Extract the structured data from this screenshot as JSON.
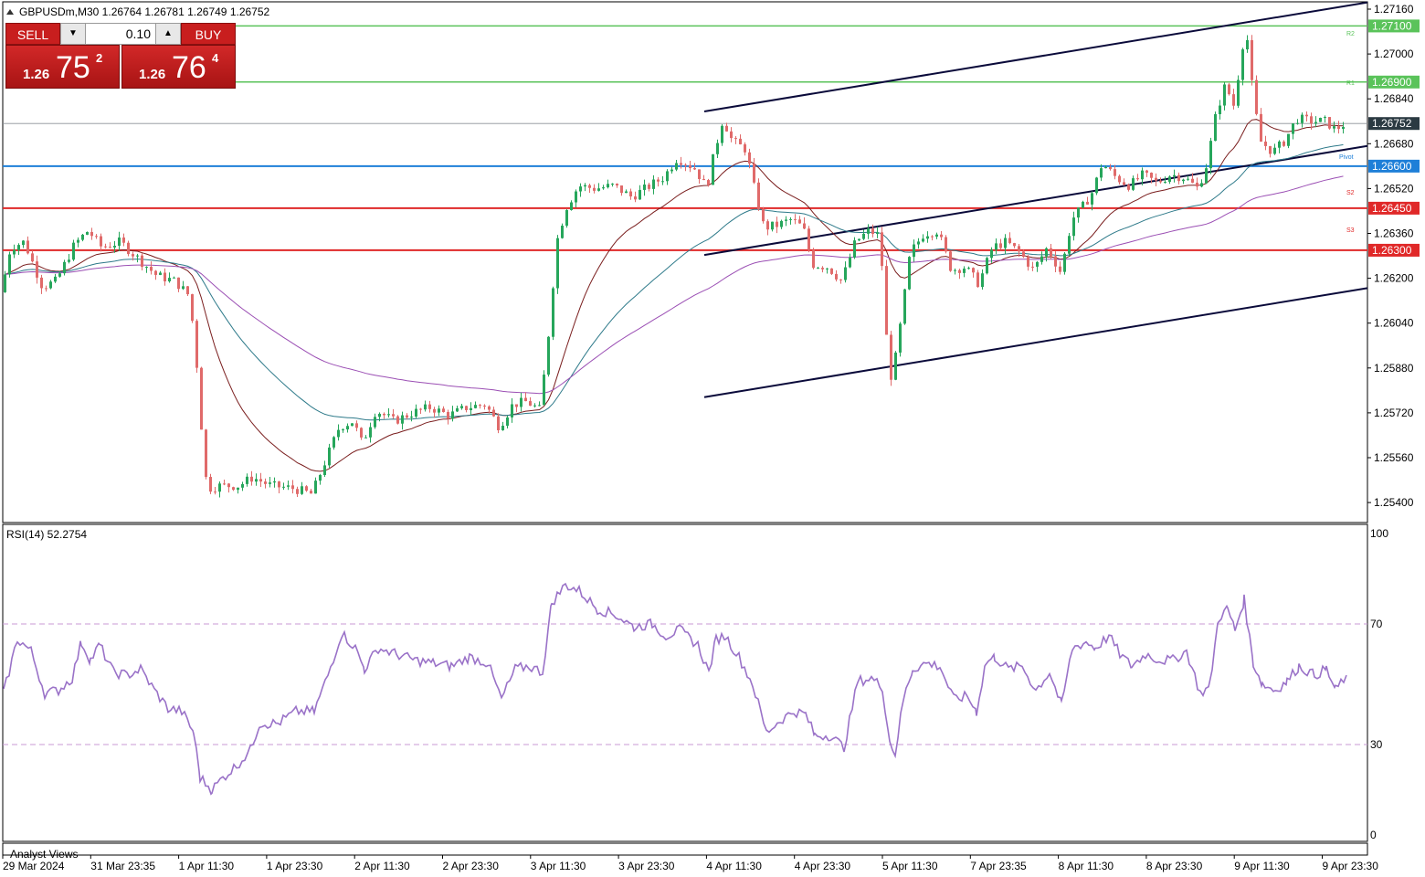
{
  "header": {
    "symbol_info": "GBPUSDm,M30  1.26764 1.26781 1.26749 1.26752"
  },
  "trade_panel": {
    "sell_label": "SELL",
    "buy_label": "BUY",
    "lot": "0.10",
    "sell_price_small": "1.26",
    "sell_price_big": "75",
    "sell_price_sup": "2",
    "buy_price_small": "1.26",
    "buy_price_big": "76",
    "buy_price_sup": "4"
  },
  "colors": {
    "bull": "#26a65b",
    "bear": "#e06a6a",
    "resistance": "#5ac35a",
    "pivot": "#1e7fd8",
    "support": "#e02828",
    "channel": "#0a0a3a",
    "ma_fast": "#7a1e1e",
    "ma_mid": "#2e7a8a",
    "ma_slow": "#9b4fb4",
    "rsi": "#9a72c8",
    "current_price_box": "#2b3a42"
  },
  "rsi_panel": {
    "label": "RSI(14) 52.2754",
    "level_labels": [
      "100",
      "70",
      "30",
      "0"
    ]
  },
  "analyst_label": "Analyst Views",
  "level_tags": {
    "r2": "R2",
    "r1": "R1",
    "pivot": "Pivot",
    "s2": "S2",
    "s3": "S3"
  },
  "chart_data": [
    {
      "type": "candlestick",
      "title": "GBPUSDm,M30",
      "x_tick_labels": [
        "29 Mar 2024",
        "31 Mar 23:35",
        "1 Apr 11:30",
        "1 Apr 23:30",
        "2 Apr 11:30",
        "2 Apr 23:30",
        "3 Apr 11:30",
        "3 Apr 23:30",
        "4 Apr 11:30",
        "4 Apr 23:30",
        "5 Apr 11:30",
        "7 Apr 23:35",
        "8 Apr 11:30",
        "8 Apr 23:30",
        "9 Apr 11:30",
        "9 Apr 23:30"
      ],
      "y_tick_labels": [
        "1.27160",
        "1.27000",
        "1.26840",
        "1.26680",
        "1.26520",
        "1.26360",
        "1.26200",
        "1.26040",
        "1.25880",
        "1.25720",
        "1.25560",
        "1.25400"
      ],
      "ylim": [
        1.2534,
        1.2719
      ],
      "horizontal_levels": [
        {
          "label": "1.27100",
          "value": 1.271,
          "kind": "resistance"
        },
        {
          "label": "1.26900",
          "value": 1.269,
          "kind": "resistance"
        },
        {
          "label": "1.26600",
          "value": 1.266,
          "kind": "pivot"
        },
        {
          "label": "1.26450",
          "value": 1.2645,
          "kind": "support"
        },
        {
          "label": "1.26300",
          "value": 1.263,
          "kind": "support"
        }
      ],
      "current_price": {
        "label": "1.26752",
        "value": 1.26752
      },
      "close_path": [
        {
          "x": 0,
          "y": 1.2615
        },
        {
          "x": 10,
          "y": 1.2631
        },
        {
          "x": 25,
          "y": 1.2633
        },
        {
          "x": 45,
          "y": 1.2617
        },
        {
          "x": 60,
          "y": 1.2619
        },
        {
          "x": 80,
          "y": 1.2632
        },
        {
          "x": 95,
          "y": 1.2637
        },
        {
          "x": 110,
          "y": 1.2631
        },
        {
          "x": 130,
          "y": 1.2633
        },
        {
          "x": 150,
          "y": 1.2627
        },
        {
          "x": 170,
          "y": 1.2621
        },
        {
          "x": 190,
          "y": 1.2619
        },
        {
          "x": 205,
          "y": 1.2614
        },
        {
          "x": 212,
          "y": 1.2598
        },
        {
          "x": 218,
          "y": 1.2571
        },
        {
          "x": 225,
          "y": 1.2545
        },
        {
          "x": 240,
          "y": 1.2546
        },
        {
          "x": 260,
          "y": 1.2546
        },
        {
          "x": 275,
          "y": 1.2549
        },
        {
          "x": 295,
          "y": 1.2546
        },
        {
          "x": 320,
          "y": 1.2545
        },
        {
          "x": 340,
          "y": 1.2543
        },
        {
          "x": 355,
          "y": 1.2555
        },
        {
          "x": 370,
          "y": 1.2567
        },
        {
          "x": 385,
          "y": 1.2569
        },
        {
          "x": 395,
          "y": 1.2561
        },
        {
          "x": 410,
          "y": 1.2573
        },
        {
          "x": 430,
          "y": 1.2569
        },
        {
          "x": 450,
          "y": 1.2572
        },
        {
          "x": 470,
          "y": 1.2574
        },
        {
          "x": 490,
          "y": 1.2571
        },
        {
          "x": 510,
          "y": 1.2574
        },
        {
          "x": 530,
          "y": 1.2575
        },
        {
          "x": 545,
          "y": 1.2567
        },
        {
          "x": 560,
          "y": 1.2575
        },
        {
          "x": 575,
          "y": 1.2576
        },
        {
          "x": 590,
          "y": 1.2573
        },
        {
          "x": 600,
          "y": 1.2603
        },
        {
          "x": 608,
          "y": 1.2633
        },
        {
          "x": 618,
          "y": 1.2645
        },
        {
          "x": 632,
          "y": 1.2653
        },
        {
          "x": 650,
          "y": 1.2652
        },
        {
          "x": 670,
          "y": 1.2653
        },
        {
          "x": 690,
          "y": 1.2649
        },
        {
          "x": 710,
          "y": 1.2653
        },
        {
          "x": 725,
          "y": 1.2656
        },
        {
          "x": 740,
          "y": 1.2663
        },
        {
          "x": 760,
          "y": 1.2659
        },
        {
          "x": 772,
          "y": 1.2652
        },
        {
          "x": 780,
          "y": 1.2664
        },
        {
          "x": 790,
          "y": 1.2677
        },
        {
          "x": 800,
          "y": 1.2669
        },
        {
          "x": 815,
          "y": 1.2666
        },
        {
          "x": 825,
          "y": 1.2651
        },
        {
          "x": 835,
          "y": 1.2638
        },
        {
          "x": 850,
          "y": 1.2639
        },
        {
          "x": 865,
          "y": 1.2641
        },
        {
          "x": 878,
          "y": 1.2638
        },
        {
          "x": 888,
          "y": 1.2625
        },
        {
          "x": 905,
          "y": 1.2624
        },
        {
          "x": 920,
          "y": 1.2619
        },
        {
          "x": 935,
          "y": 1.2633
        },
        {
          "x": 950,
          "y": 1.2637
        },
        {
          "x": 962,
          "y": 1.2635
        },
        {
          "x": 970,
          "y": 1.2594
        },
        {
          "x": 975,
          "y": 1.2583
        },
        {
          "x": 985,
          "y": 1.2605
        },
        {
          "x": 995,
          "y": 1.2629
        },
        {
          "x": 1010,
          "y": 1.2636
        },
        {
          "x": 1025,
          "y": 1.2637
        },
        {
          "x": 1040,
          "y": 1.2623
        },
        {
          "x": 1055,
          "y": 1.2624
        },
        {
          "x": 1070,
          "y": 1.2618
        },
        {
          "x": 1085,
          "y": 1.2631
        },
        {
          "x": 1100,
          "y": 1.2633
        },
        {
          "x": 1115,
          "y": 1.2629
        },
        {
          "x": 1130,
          "y": 1.2623
        },
        {
          "x": 1145,
          "y": 1.2631
        },
        {
          "x": 1160,
          "y": 1.2622
        },
        {
          "x": 1172,
          "y": 1.2641
        },
        {
          "x": 1185,
          "y": 1.2646
        },
        {
          "x": 1195,
          "y": 1.2651
        },
        {
          "x": 1205,
          "y": 1.2661
        },
        {
          "x": 1220,
          "y": 1.2656
        },
        {
          "x": 1235,
          "y": 1.2653
        },
        {
          "x": 1250,
          "y": 1.2657
        },
        {
          "x": 1265,
          "y": 1.2654
        },
        {
          "x": 1280,
          "y": 1.2657
        },
        {
          "x": 1295,
          "y": 1.2656
        },
        {
          "x": 1310,
          "y": 1.2652
        },
        {
          "x": 1320,
          "y": 1.2661
        },
        {
          "x": 1330,
          "y": 1.2679
        },
        {
          "x": 1340,
          "y": 1.2689
        },
        {
          "x": 1350,
          "y": 1.2681
        },
        {
          "x": 1358,
          "y": 1.2703
        },
        {
          "x": 1364,
          "y": 1.2705
        },
        {
          "x": 1370,
          "y": 1.2686
        },
        {
          "x": 1378,
          "y": 1.2669
        },
        {
          "x": 1392,
          "y": 1.2665
        },
        {
          "x": 1405,
          "y": 1.2669
        },
        {
          "x": 1418,
          "y": 1.2677
        },
        {
          "x": 1435,
          "y": 1.2676
        },
        {
          "x": 1450,
          "y": 1.2676
        },
        {
          "x": 1460,
          "y": 1.2673
        },
        {
          "x": 1470,
          "y": 1.2675
        }
      ]
    },
    {
      "type": "line",
      "title": "RSI(14) 52.2754",
      "ylim": [
        0,
        100
      ],
      "y_ticks": [
        0,
        30,
        70,
        100
      ],
      "reference_levels": [
        70,
        30
      ],
      "series": [
        {
          "name": "RSI(14)",
          "points": [
            {
              "x": 0,
              "y": 47
            },
            {
              "x": 15,
              "y": 65
            },
            {
              "x": 30,
              "y": 61
            },
            {
              "x": 45,
              "y": 47
            },
            {
              "x": 60,
              "y": 48
            },
            {
              "x": 75,
              "y": 52
            },
            {
              "x": 85,
              "y": 64
            },
            {
              "x": 95,
              "y": 58
            },
            {
              "x": 105,
              "y": 63
            },
            {
              "x": 120,
              "y": 54
            },
            {
              "x": 135,
              "y": 53
            },
            {
              "x": 150,
              "y": 55
            },
            {
              "x": 165,
              "y": 48
            },
            {
              "x": 180,
              "y": 42
            },
            {
              "x": 195,
              "y": 41
            },
            {
              "x": 208,
              "y": 34
            },
            {
              "x": 215,
              "y": 19
            },
            {
              "x": 228,
              "y": 15
            },
            {
              "x": 240,
              "y": 19
            },
            {
              "x": 255,
              "y": 23
            },
            {
              "x": 270,
              "y": 28
            },
            {
              "x": 280,
              "y": 37
            },
            {
              "x": 300,
              "y": 37
            },
            {
              "x": 320,
              "y": 41
            },
            {
              "x": 340,
              "y": 41
            },
            {
              "x": 355,
              "y": 53
            },
            {
              "x": 370,
              "y": 67
            },
            {
              "x": 385,
              "y": 62
            },
            {
              "x": 395,
              "y": 55
            },
            {
              "x": 410,
              "y": 62
            },
            {
              "x": 430,
              "y": 60
            },
            {
              "x": 450,
              "y": 58
            },
            {
              "x": 470,
              "y": 57
            },
            {
              "x": 490,
              "y": 56
            },
            {
              "x": 510,
              "y": 59
            },
            {
              "x": 530,
              "y": 57
            },
            {
              "x": 545,
              "y": 45
            },
            {
              "x": 560,
              "y": 55
            },
            {
              "x": 575,
              "y": 56
            },
            {
              "x": 590,
              "y": 54
            },
            {
              "x": 600,
              "y": 77
            },
            {
              "x": 615,
              "y": 83
            },
            {
              "x": 630,
              "y": 81
            },
            {
              "x": 650,
              "y": 75
            },
            {
              "x": 670,
              "y": 73
            },
            {
              "x": 690,
              "y": 69
            },
            {
              "x": 710,
              "y": 70
            },
            {
              "x": 725,
              "y": 66
            },
            {
              "x": 740,
              "y": 68
            },
            {
              "x": 760,
              "y": 63
            },
            {
              "x": 772,
              "y": 54
            },
            {
              "x": 780,
              "y": 65
            },
            {
              "x": 790,
              "y": 66
            },
            {
              "x": 805,
              "y": 59
            },
            {
              "x": 820,
              "y": 50
            },
            {
              "x": 835,
              "y": 34
            },
            {
              "x": 850,
              "y": 38
            },
            {
              "x": 865,
              "y": 41
            },
            {
              "x": 878,
              "y": 40
            },
            {
              "x": 888,
              "y": 33
            },
            {
              "x": 905,
              "y": 33
            },
            {
              "x": 920,
              "y": 29
            },
            {
              "x": 935,
              "y": 51
            },
            {
              "x": 950,
              "y": 52
            },
            {
              "x": 962,
              "y": 49
            },
            {
              "x": 970,
              "y": 31
            },
            {
              "x": 976,
              "y": 27
            },
            {
              "x": 985,
              "y": 45
            },
            {
              "x": 995,
              "y": 55
            },
            {
              "x": 1010,
              "y": 57
            },
            {
              "x": 1025,
              "y": 56
            },
            {
              "x": 1040,
              "y": 45
            },
            {
              "x": 1055,
              "y": 46
            },
            {
              "x": 1065,
              "y": 41
            },
            {
              "x": 1075,
              "y": 57
            },
            {
              "x": 1085,
              "y": 59
            },
            {
              "x": 1100,
              "y": 55
            },
            {
              "x": 1115,
              "y": 56
            },
            {
              "x": 1130,
              "y": 48
            },
            {
              "x": 1145,
              "y": 54
            },
            {
              "x": 1158,
              "y": 43
            },
            {
              "x": 1170,
              "y": 62
            },
            {
              "x": 1185,
              "y": 64
            },
            {
              "x": 1195,
              "y": 62
            },
            {
              "x": 1210,
              "y": 66
            },
            {
              "x": 1222,
              "y": 60
            },
            {
              "x": 1235,
              "y": 56
            },
            {
              "x": 1250,
              "y": 60
            },
            {
              "x": 1265,
              "y": 58
            },
            {
              "x": 1280,
              "y": 58
            },
            {
              "x": 1295,
              "y": 61
            },
            {
              "x": 1310,
              "y": 47
            },
            {
              "x": 1320,
              "y": 49
            },
            {
              "x": 1330,
              "y": 72
            },
            {
              "x": 1340,
              "y": 75
            },
            {
              "x": 1348,
              "y": 68
            },
            {
              "x": 1358,
              "y": 78
            },
            {
              "x": 1368,
              "y": 57
            },
            {
              "x": 1378,
              "y": 50
            },
            {
              "x": 1392,
              "y": 48
            },
            {
              "x": 1405,
              "y": 51
            },
            {
              "x": 1418,
              "y": 56
            },
            {
              "x": 1435,
              "y": 53
            },
            {
              "x": 1448,
              "y": 55
            },
            {
              "x": 1458,
              "y": 48
            },
            {
              "x": 1470,
              "y": 53
            }
          ]
        }
      ]
    }
  ]
}
